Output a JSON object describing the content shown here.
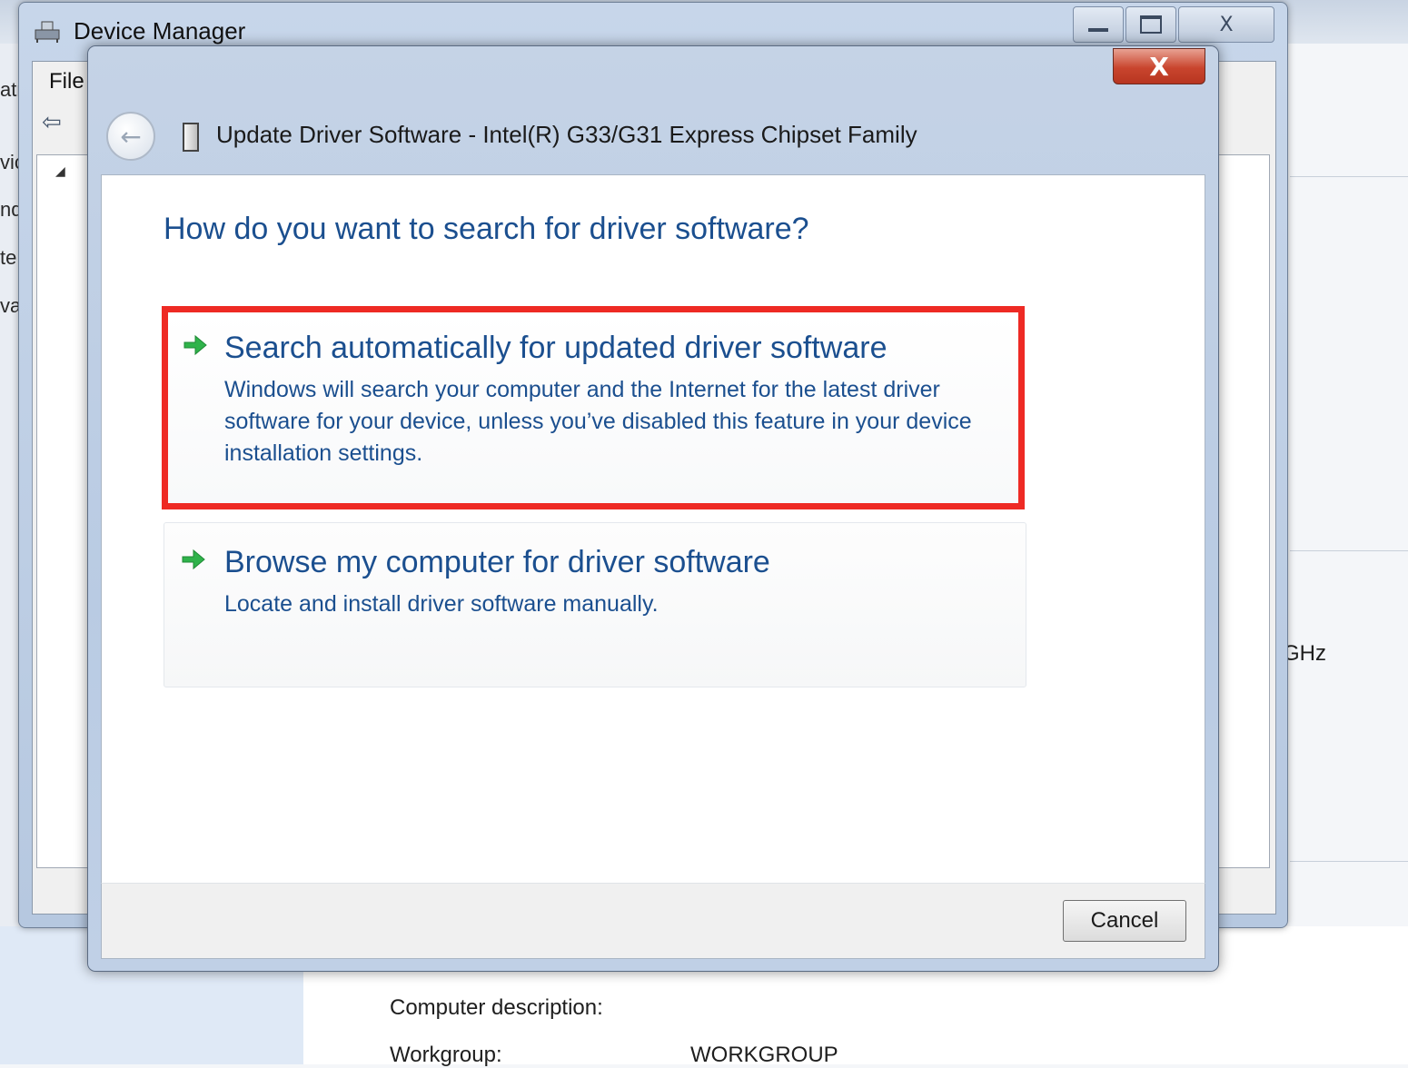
{
  "background": {
    "left_edge_fragments": [
      "atr",
      "vic",
      "nd",
      "te",
      "va"
    ],
    "side_text": "GHz",
    "computer_description_label": "Computer description:",
    "workgroup_label": "Workgroup:",
    "workgroup_value": "WORKGROUP"
  },
  "device_manager": {
    "title": "Device Manager",
    "menu_file": "File",
    "minimize_icon": "minimize-icon",
    "maximize_icon": "maximize-icon",
    "close_glyph": "X"
  },
  "dialog": {
    "title": "Update Driver Software - Intel(R) G33/G31 Express Chipset Family",
    "close_glyph": "X",
    "question": "How do you want to search for driver software?",
    "options": [
      {
        "title": "Search automatically for updated driver software",
        "description": "Windows will search your computer and the Internet for the latest driver software for your device, unless you’ve disabled this feature in your device installation settings."
      },
      {
        "title": "Browse my computer for driver software",
        "description": "Locate and install driver software manually."
      }
    ],
    "cancel_label": "Cancel"
  },
  "colors": {
    "highlight_border": "#ee2a24",
    "link_blue": "#1b4f8f",
    "arrow_green": "#2fb34a"
  }
}
